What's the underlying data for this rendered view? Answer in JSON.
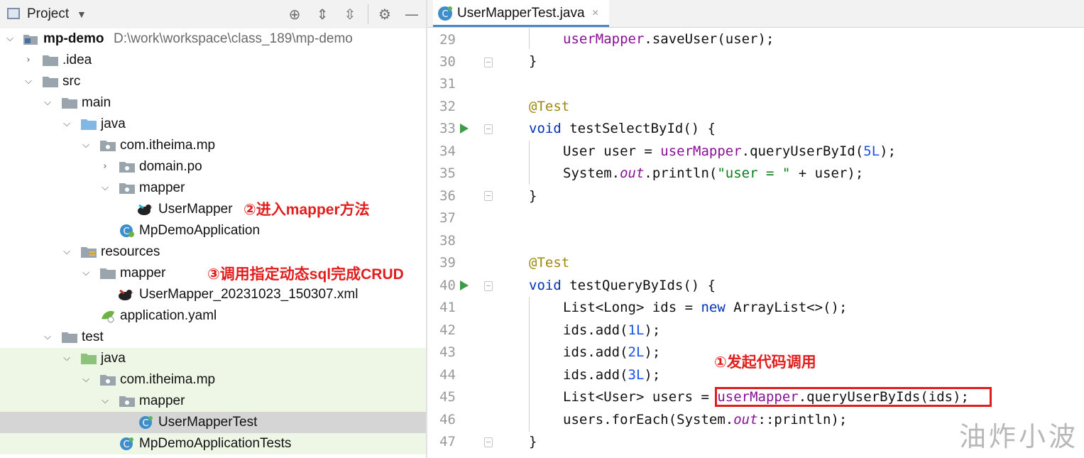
{
  "project": {
    "title": "Project",
    "dropdown_icon": "caret-down-icon",
    "header_icons": [
      "target-icon",
      "expand-all-icon",
      "collapse-all-icon",
      "gear-icon",
      "minimize-icon"
    ],
    "tree": [
      {
        "label": "mp-demo",
        "path": "D:\\work\\workspace\\class_189\\mp-demo",
        "icon": "module-icon",
        "expanded": true
      },
      {
        "label": ".idea",
        "icon": "folder-icon",
        "expanded": false
      },
      {
        "label": "src",
        "icon": "folder-icon",
        "expanded": true
      },
      {
        "label": "main",
        "icon": "folder-icon",
        "expanded": true
      },
      {
        "label": "java",
        "icon": "source-folder-icon",
        "expanded": true
      },
      {
        "label": "com.itheima.mp",
        "icon": "package-icon",
        "expanded": true
      },
      {
        "label": "domain.po",
        "icon": "package-icon",
        "expanded": false
      },
      {
        "label": "mapper",
        "icon": "package-icon",
        "expanded": true
      },
      {
        "label": "UserMapper",
        "icon": "mybatis-bird-icon"
      },
      {
        "label": "MpDemoApplication",
        "icon": "spring-class-icon"
      },
      {
        "label": "resources",
        "icon": "resources-folder-icon",
        "expanded": true
      },
      {
        "label": "mapper",
        "icon": "folder-icon",
        "expanded": true
      },
      {
        "label": "UserMapper_20231023_150307.xml",
        "icon": "mybatis-xml-icon"
      },
      {
        "label": "application.yaml",
        "icon": "spring-yaml-icon"
      },
      {
        "label": "test",
        "icon": "folder-icon",
        "expanded": true
      },
      {
        "label": "java",
        "icon": "test-folder-icon",
        "expanded": true
      },
      {
        "label": "com.itheima.mp",
        "icon": "package-icon",
        "expanded": true
      },
      {
        "label": "mapper",
        "icon": "package-icon",
        "expanded": true
      },
      {
        "label": "UserMapperTest",
        "icon": "test-class-icon",
        "selected": true
      },
      {
        "label": "MpDemoApplicationTests",
        "icon": "test-class-icon"
      }
    ],
    "annotations": {
      "step2": "②进入mapper方法",
      "step3": "③调用指定动态sql完成CRUD"
    }
  },
  "editor": {
    "tab_label": "UserMapperTest.java",
    "tab_close": "×",
    "line_numbers": [
      "29",
      "30",
      "31",
      "32",
      "33",
      "34",
      "35",
      "36",
      "37",
      "38",
      "39",
      "40",
      "41",
      "42",
      "43",
      "44",
      "45",
      "46",
      "47"
    ],
    "code": {
      "l29": [
        "userMapper",
        ".saveUser(user);"
      ],
      "l30": "}",
      "l32": "@Test",
      "l33": [
        "void",
        " testSelectById() {"
      ],
      "l34": [
        "User user = ",
        "userMapper",
        ".queryUserById(",
        "5L",
        ");"
      ],
      "l35": [
        "System.",
        "out",
        ".println(",
        "\"user = \"",
        " + user);"
      ],
      "l36": "}",
      "l39": "@Test",
      "l40": [
        "void",
        " testQueryByIds() {"
      ],
      "l41": [
        "List<Long> ids = ",
        "new",
        " ArrayList<>();"
      ],
      "l42": [
        "ids.add(",
        "1L",
        ");"
      ],
      "l43": [
        "ids.add(",
        "2L",
        ");"
      ],
      "l44": [
        "ids.add(",
        "3L",
        ");"
      ],
      "l45": [
        "List<User> users = ",
        "userMapper",
        ".queryUserByIds(ids);"
      ],
      "l46": [
        "users.forEach(System.",
        "out",
        "::println);"
      ],
      "l47": "}"
    },
    "annotation_step1": "①发起代码调用",
    "watermark": "油炸小波"
  },
  "colors": {
    "keyword": "#0033b3",
    "field": "#871094",
    "annotation": "#9e880d",
    "number": "#1750eb",
    "string": "#067d17",
    "highlight_box": "#e01e1e",
    "annotation_text": "#e21d1d",
    "test_row_bg": "#eef7e5",
    "selected_row_bg": "#d5d5d5"
  }
}
